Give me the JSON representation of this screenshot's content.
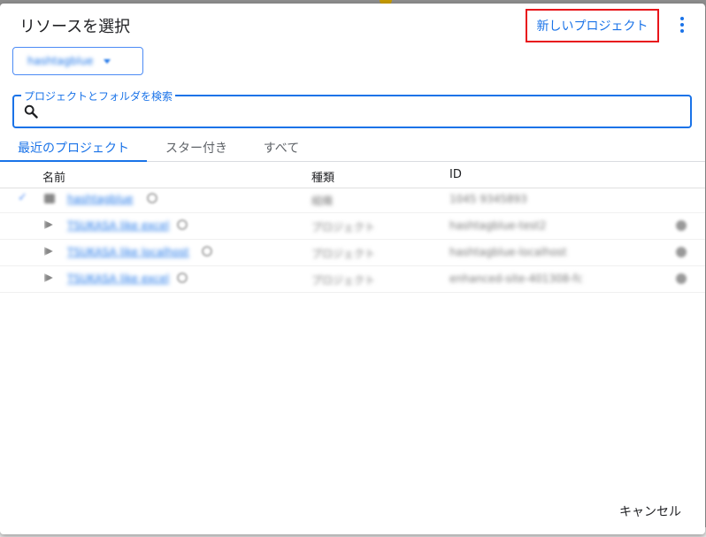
{
  "dialog": {
    "title": "リソースを選択",
    "new_project_label": "新しいプロジェクト",
    "org_select_value": "hashtagblue",
    "search": {
      "label": "プロジェクトとフォルダを検索",
      "value": "",
      "placeholder": ""
    },
    "tabs": [
      {
        "label": "最近のプロジェクト",
        "active": true
      },
      {
        "label": "スター付き",
        "active": false
      },
      {
        "label": "すべて",
        "active": false
      }
    ],
    "columns": {
      "name": "名前",
      "type": "種類",
      "id": "ID"
    },
    "rows": [
      {
        "name": "hashtagblue",
        "type": "組織",
        "id": "1045 9345893",
        "selected": true
      },
      {
        "name": "TSUKASA like excel",
        "type": "プロジェクト",
        "id": "hashtagblue-test2",
        "selected": false
      },
      {
        "name": "TSUKASA like localhost",
        "type": "プロジェクト",
        "id": "hashtagblue-localhost",
        "selected": false
      },
      {
        "name": "TSUKASA like excel",
        "type": "プロジェクト",
        "id": "enhanced-site-401308-fc",
        "selected": false
      }
    ],
    "cancel_label": "キャンセル"
  },
  "colors": {
    "accent": "#1a73e8",
    "highlight_border": "#e8141a"
  }
}
